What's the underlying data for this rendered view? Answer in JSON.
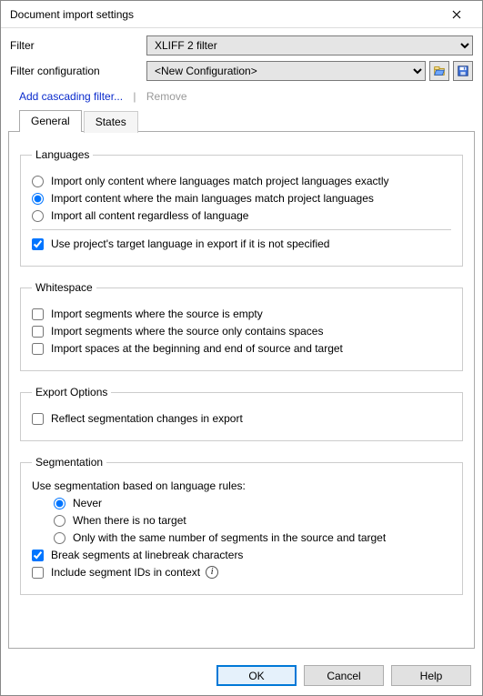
{
  "title": "Document import settings",
  "filter": {
    "label": "Filter",
    "value": "XLIFF 2 filter"
  },
  "filterConfig": {
    "label": "Filter configuration",
    "value": "<New Configuration>"
  },
  "links": {
    "add": "Add cascading filter...",
    "sep": "|",
    "remove": "Remove"
  },
  "tabs": {
    "general": "General",
    "states": "States"
  },
  "languages": {
    "legend": "Languages",
    "opt1": "Import only content where languages match project languages exactly",
    "opt2": "Import content where the main languages match project languages",
    "opt3": "Import all content regardless of language",
    "chk1": "Use project's target language in export if it is not specified"
  },
  "whitespace": {
    "legend": "Whitespace",
    "chk1": "Import segments where the source is empty",
    "chk2": "Import segments where the source only contains spaces",
    "chk3": "Import spaces at the beginning and end of source and target"
  },
  "export": {
    "legend": "Export Options",
    "chk1": "Reflect segmentation changes in export"
  },
  "segmentation": {
    "legend": "Segmentation",
    "intro": "Use segmentation based on language rules:",
    "opt1": "Never",
    "opt2": "When there is no target",
    "opt3": "Only with the same number of segments in the source and target",
    "chk1": "Break segments at linebreak characters",
    "chk2": "Include segment IDs in context"
  },
  "buttons": {
    "ok": "OK",
    "cancel": "Cancel",
    "help": "Help"
  }
}
